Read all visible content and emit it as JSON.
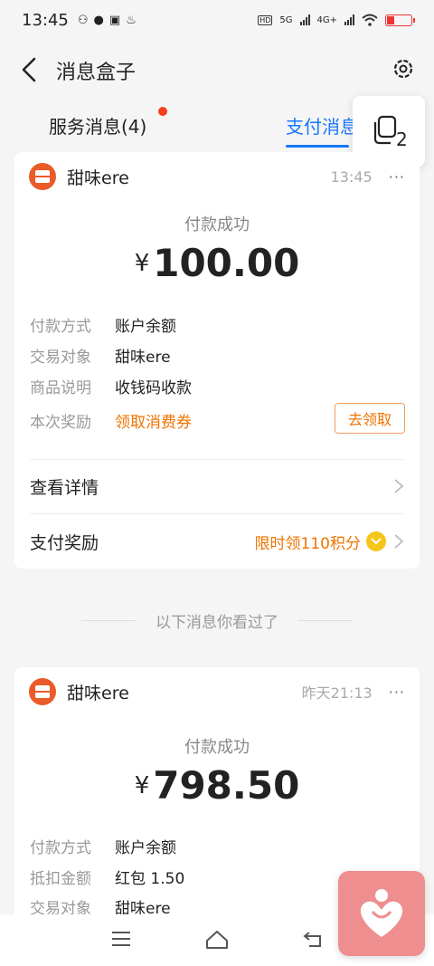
{
  "status_bar": {
    "time": "13:45",
    "hd_label": "HD",
    "net1": "5G",
    "net2": "4G+"
  },
  "header": {
    "title": "消息盒子"
  },
  "tabs": [
    {
      "label": "服务消息(4)",
      "has_dot": true
    },
    {
      "label": "支付消息",
      "active": true
    }
  ],
  "floating_tabs_count": "2",
  "cards": [
    {
      "merchant": "甜味ere",
      "time": "13:45",
      "more": "···",
      "status": "付款成功",
      "currency": "¥",
      "amount": "100.00",
      "details": [
        {
          "key": "付款方式",
          "value": "账户余额"
        },
        {
          "key": "交易对象",
          "value": "甜味ere"
        },
        {
          "key": "商品说明",
          "value": "收钱码收款"
        },
        {
          "key": "本次奖励",
          "value": "领取消费券"
        }
      ],
      "claim_button": "去领取",
      "view_details": "查看详情",
      "pay_reward_label": "支付奖励",
      "pay_reward_value": "限时领110积分"
    },
    {
      "merchant": "甜味ere",
      "time": "昨天21:13",
      "more": "···",
      "status": "付款成功",
      "currency": "¥",
      "amount": "798.50",
      "details": [
        {
          "key": "付款方式",
          "value": "账户余额"
        },
        {
          "key": "抵扣金额",
          "value": "红包 1.50"
        },
        {
          "key": "交易对象",
          "value": "甜味ere"
        }
      ]
    }
  ],
  "seen_divider": "以下消息你看过了",
  "colors": {
    "accent_blue": "#1677ff",
    "orange": "#f07300",
    "merchant_logo": "#ea5b2a",
    "badge_red": "#f2421b"
  }
}
